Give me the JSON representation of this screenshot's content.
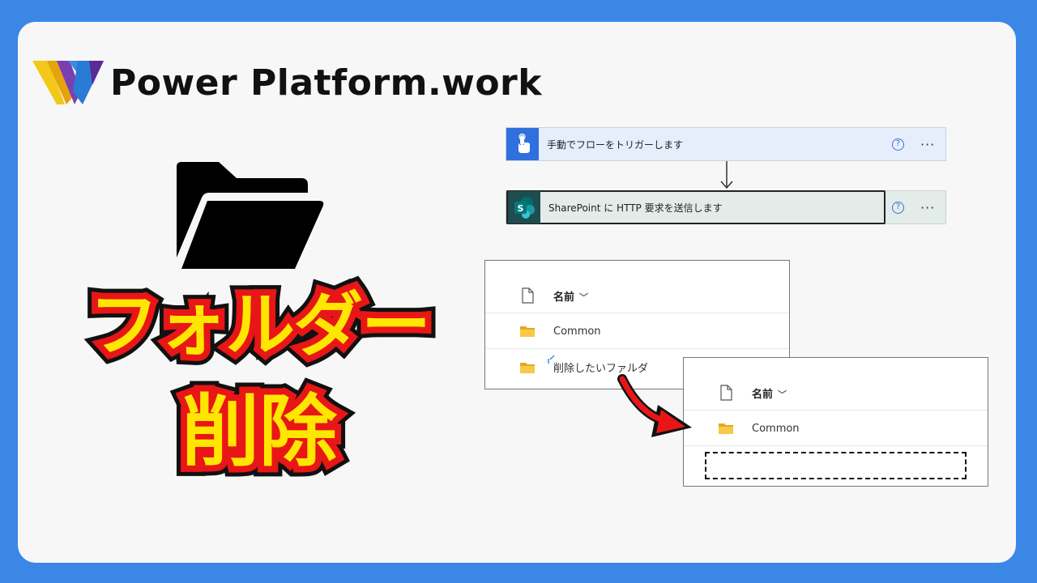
{
  "brand": {
    "name": "Power Platform.work",
    "logo_icon": "pp-w-logo-icon"
  },
  "title": {
    "line1": "フォルダー",
    "line2": "削除",
    "fill_color": "#ffe600",
    "stroke_color": "#e81616"
  },
  "flow": {
    "steps": [
      {
        "label": "手動でフローをトリガーします",
        "icon": "touch-trigger-icon",
        "icon_bg": "#2f6fde",
        "help": "?",
        "more": "···"
      },
      {
        "label": "SharePoint に HTTP 要求を送信します",
        "icon": "sharepoint-icon",
        "icon_bg": "#036c70",
        "icon_letter": "S",
        "help": "?",
        "more": "···"
      }
    ]
  },
  "list_before": {
    "header": "名前",
    "rows": [
      "Common",
      "削除したいファルダ"
    ]
  },
  "list_after": {
    "header": "名前",
    "rows": [
      "Common"
    ]
  },
  "colors": {
    "background": "#3a87e6",
    "card": "#f7f7f7",
    "folder": "#f3c33c"
  }
}
